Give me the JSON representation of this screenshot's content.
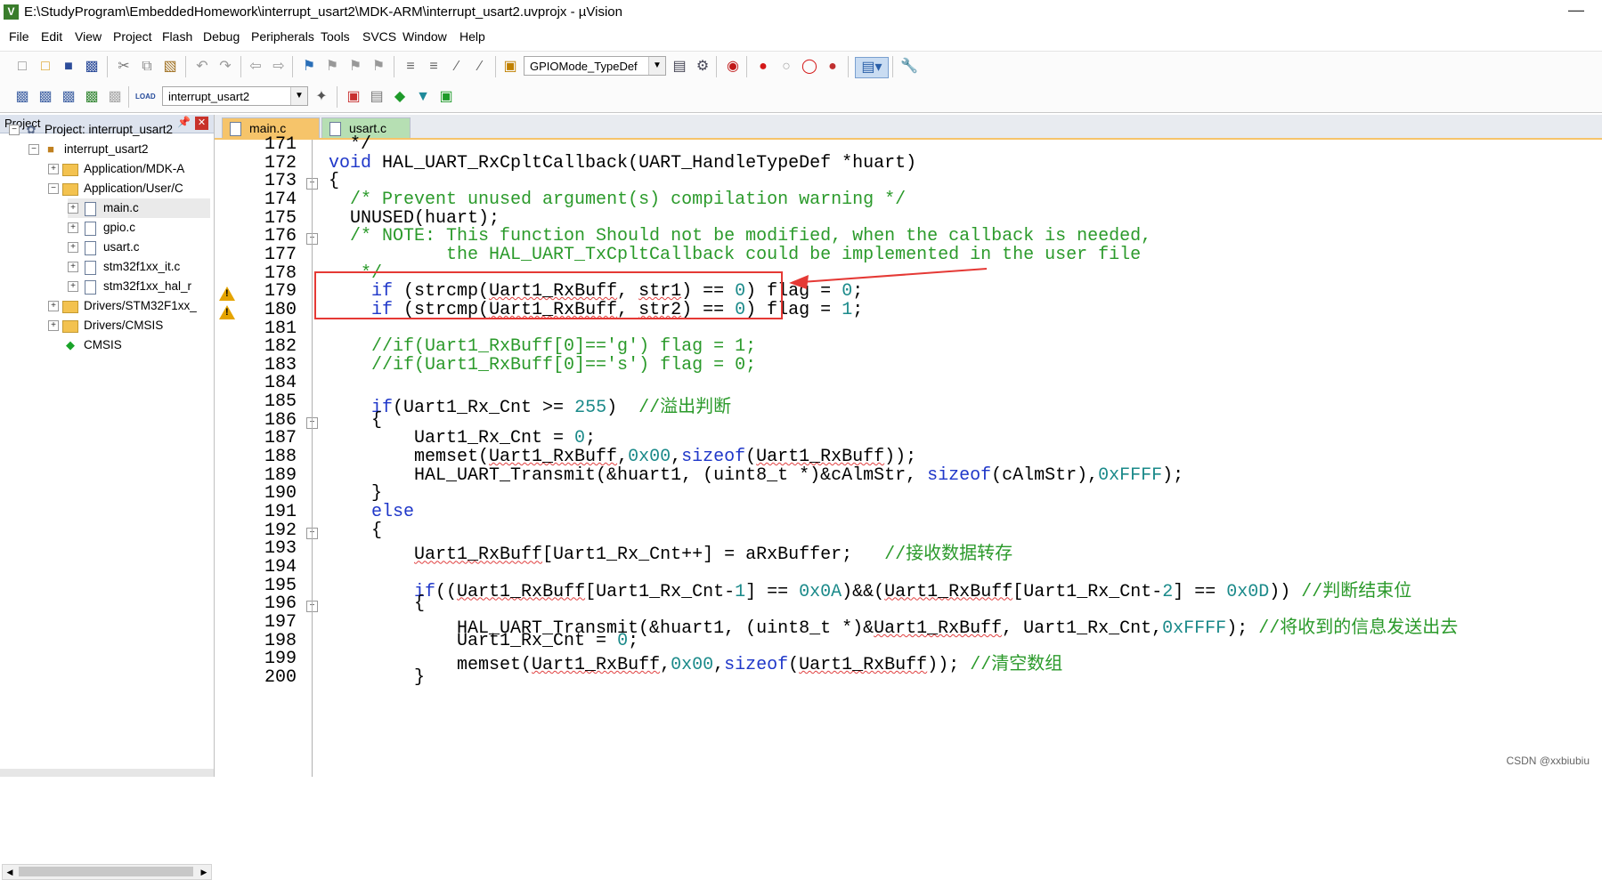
{
  "window": {
    "title": "E:\\StudyProgram\\EmbeddedHomework\\interrupt_usart2\\MDK-ARM\\interrupt_usart2.uvprojx - µVision",
    "icon": "V"
  },
  "menu": [
    "File",
    "Edit",
    "View",
    "Project",
    "Flash",
    "Debug",
    "Peripherals",
    "Tools",
    "SVCS",
    "Window",
    "Help"
  ],
  "toolbar": {
    "find_combo": "GPIOMode_TypeDef",
    "target_combo": "interrupt_usart2",
    "load_label": "LOAD"
  },
  "project_panel": {
    "title": "Project",
    "tree": [
      {
        "label": "Project: interrupt_usart2",
        "icon": "project-icon",
        "expander": "−",
        "level": 0
      },
      {
        "label": "interrupt_usart2",
        "icon": "target-icon",
        "expander": "−",
        "level": 1
      },
      {
        "label": "Application/MDK-A",
        "icon": "folder-icon",
        "expander": "+",
        "level": 2
      },
      {
        "label": "Application/User/C",
        "icon": "folder-icon",
        "expander": "−",
        "level": 2
      },
      {
        "label": "main.c",
        "icon": "file-icon",
        "expander": "+",
        "level": 3,
        "selected": true
      },
      {
        "label": "gpio.c",
        "icon": "file-icon",
        "expander": "+",
        "level": 3
      },
      {
        "label": "usart.c",
        "icon": "file-icon",
        "expander": "+",
        "level": 3
      },
      {
        "label": "stm32f1xx_it.c",
        "icon": "file-icon",
        "expander": "+",
        "level": 3
      },
      {
        "label": "stm32f1xx_hal_r",
        "icon": "file-icon",
        "expander": "+",
        "level": 3
      },
      {
        "label": "Drivers/STM32F1xx_",
        "icon": "folder-icon",
        "expander": "+",
        "level": 2
      },
      {
        "label": "Drivers/CMSIS",
        "icon": "folder-icon",
        "expander": "+",
        "level": 2
      },
      {
        "label": "CMSIS",
        "icon": "cmsis-icon",
        "expander": "",
        "level": 2
      }
    ]
  },
  "tabs": [
    {
      "label": "main.c",
      "active": true
    },
    {
      "label": "usart.c",
      "active": false
    }
  ],
  "code_lines": [
    {
      "n": "171",
      "text": "  */"
    },
    {
      "n": "172",
      "text": "void HAL_UART_RxCpltCallback(UART_HandleTypeDef *huart)"
    },
    {
      "n": "173",
      "text": "{"
    },
    {
      "n": "174",
      "text": "  /* Prevent unused argument(s) compilation warning */"
    },
    {
      "n": "175",
      "text": "  UNUSED(huart);"
    },
    {
      "n": "176",
      "text": "  /* NOTE: This function Should not be modified, when the callback is needed,"
    },
    {
      "n": "177",
      "text": "           the HAL_UART_TxCpltCallback could be implemented in the user file"
    },
    {
      "n": "178",
      "text": "   */"
    },
    {
      "n": "179",
      "text": "    if (strcmp(Uart1_RxBuff, str1) == 0) flag = 0;"
    },
    {
      "n": "180",
      "text": "    if (strcmp(Uart1_RxBuff, str2) == 0) flag = 1;"
    },
    {
      "n": "181",
      "text": ""
    },
    {
      "n": "182",
      "text": "    //if(Uart1_RxBuff[0]=='g') flag = 1;"
    },
    {
      "n": "183",
      "text": "    //if(Uart1_RxBuff[0]=='s') flag = 0;"
    },
    {
      "n": "184",
      "text": ""
    },
    {
      "n": "185",
      "text": "    if(Uart1_Rx_Cnt >= 255)  //溢出判断"
    },
    {
      "n": "186",
      "text": "    {"
    },
    {
      "n": "187",
      "text": "        Uart1_Rx_Cnt = 0;"
    },
    {
      "n": "188",
      "text": "        memset(Uart1_RxBuff,0x00,sizeof(Uart1_RxBuff));"
    },
    {
      "n": "189",
      "text": "        HAL_UART_Transmit(&huart1, (uint8_t *)&cAlmStr, sizeof(cAlmStr),0xFFFF);"
    },
    {
      "n": "190",
      "text": "    }"
    },
    {
      "n": "191",
      "text": "    else"
    },
    {
      "n": "192",
      "text": "    {"
    },
    {
      "n": "193",
      "text": "        Uart1_RxBuff[Uart1_Rx_Cnt++] = aRxBuffer;   //接收数据转存"
    },
    {
      "n": "194",
      "text": ""
    },
    {
      "n": "195",
      "text": "        if((Uart1_RxBuff[Uart1_Rx_Cnt-1] == 0x0A)&&(Uart1_RxBuff[Uart1_Rx_Cnt-2] == 0x0D)) //判断结束位"
    },
    {
      "n": "196",
      "text": "        {"
    },
    {
      "n": "197",
      "text": "            HAL_UART_Transmit(&huart1, (uint8_t *)&Uart1_RxBuff, Uart1_Rx_Cnt,0xFFFF); //将收到的信息发送出去"
    },
    {
      "n": "198",
      "text": "            Uart1_Rx_Cnt = 0;"
    },
    {
      "n": "199",
      "text": "            memset(Uart1_RxBuff,0x00,sizeof(Uart1_RxBuff)); //清空数组"
    },
    {
      "n": "200",
      "text": "        }"
    }
  ],
  "warnings": {
    "lines": [
      "179",
      "180"
    ],
    "icon": "warning-icon"
  },
  "folds": [
    "173",
    "176",
    "186",
    "192",
    "196"
  ],
  "annotation": {
    "box_color": "#e53935",
    "arrow_color": "#e53935"
  },
  "watermark": "CSDN @xxbiubiu",
  "colors": {
    "keyword": "#1f37c9",
    "comment": "#2b9a2b",
    "number": "#1b8a8a",
    "tab_active": "#f6c46a",
    "tab_inactive": "#b6dfb3"
  }
}
